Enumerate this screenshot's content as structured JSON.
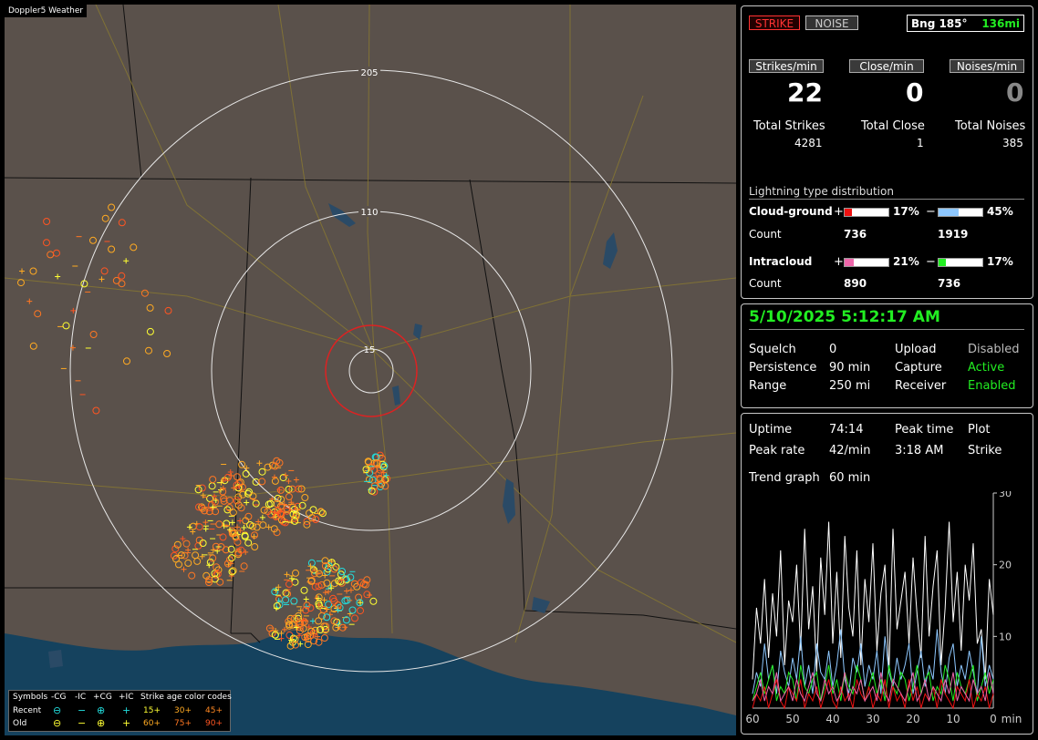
{
  "map": {
    "title": "Doppler5 Weather",
    "range_labels": [
      "205",
      "110",
      "15"
    ]
  },
  "legend": {
    "symbols_label": "Symbols",
    "headers": [
      "-CG",
      "-IC",
      "+CG",
      "+IC"
    ],
    "age_label": "Strike age color codes",
    "recent_label": "Recent",
    "old_label": "Old",
    "recent_ages": [
      "15+",
      "30+",
      "45+"
    ],
    "old_ages": [
      "60+",
      "75+",
      "90+"
    ],
    "age_colors": [
      "#ffff33",
      "#ffaa22",
      "#ff7722",
      "#ffaa22",
      "#ff7722",
      "#ff5522"
    ]
  },
  "top": {
    "strike_btn": "STRIKE",
    "noise_btn": "NOISE",
    "bearing": "Bng 185°",
    "distance": "136mi",
    "strikes_per_min_label": "Strikes/min",
    "close_per_min_label": "Close/min",
    "noises_per_min_label": "Noises/min",
    "strikes_per_min": "22",
    "close_per_min": "0",
    "noises_per_min": "0",
    "total_strikes_label": "Total Strikes",
    "total_close_label": "Total Close",
    "total_noises_label": "Total Noises",
    "total_strikes": "4281",
    "total_close": "1",
    "total_noises": "385",
    "dist_title": "Lightning type distribution",
    "cg_label": "Cloud-ground",
    "ic_label": "Intracloud",
    "count_label": "Count",
    "plus": "+",
    "minus": "−",
    "cg_plus_pct": "17%",
    "cg_minus_pct": "45%",
    "cg_plus_count": "736",
    "cg_minus_count": "1919",
    "ic_plus_pct": "21%",
    "ic_minus_pct": "17%",
    "ic_plus_count": "890",
    "ic_minus_count": "736",
    "bar_fractions": {
      "cg_plus": 0.17,
      "cg_minus": 0.45,
      "ic_plus": 0.21,
      "ic_minus": 0.17
    },
    "bar_colors": {
      "cg_plus": "#ee1111",
      "cg_minus": "#8ec8ff",
      "ic_plus": "#ee66aa",
      "ic_minus": "#22ee22"
    }
  },
  "status": {
    "datetime": "5/10/2025 5:12:17 AM",
    "squelch_label": "Squelch",
    "squelch": "0",
    "persistence_label": "Persistence",
    "persistence": "90 min",
    "range_label": "Range",
    "range": "250 mi",
    "upload_label": "Upload",
    "upload": "Disabled",
    "capture_label": "Capture",
    "capture": "Active",
    "receiver_label": "Receiver",
    "receiver": "Enabled"
  },
  "trend": {
    "uptime_label": "Uptime",
    "uptime": "74:14",
    "peak_time_label": "Peak time",
    "peak_time": "3:18 AM",
    "plot_label": "Plot",
    "peak_rate_label": "Peak rate",
    "peak_rate": "42/min",
    "plot_value": "Strike",
    "trend_label": "Trend graph",
    "trend_value": "60 min",
    "x_ticks": [
      "60",
      "50",
      "40",
      "30",
      "20",
      "10",
      "0"
    ],
    "x_unit": "min",
    "y_ticks": [
      "30",
      "20",
      "10"
    ]
  },
  "chart_data": {
    "type": "line",
    "xlim": [
      60,
      0
    ],
    "ylim": [
      0,
      30
    ],
    "x_ticks": [
      60,
      50,
      40,
      30,
      20,
      10,
      0
    ],
    "y_ticks": [
      30,
      20,
      10
    ],
    "xlabel": "min",
    "series": [
      {
        "color": "#ffffff",
        "values": [
          4,
          14,
          9,
          18,
          7,
          16,
          10,
          22,
          6,
          15,
          12,
          20,
          8,
          25,
          11,
          17,
          5,
          21,
          13,
          26,
          9,
          19,
          7,
          24,
          14,
          10,
          22,
          6,
          18,
          12,
          23,
          8,
          16,
          20,
          5,
          25,
          11,
          15,
          19,
          9,
          21,
          13,
          7,
          24,
          10,
          17,
          22,
          6,
          14,
          26,
          12,
          19,
          8,
          20,
          15,
          23,
          9,
          11,
          4,
          18,
          13
        ]
      },
      {
        "color": "#8ec8ff",
        "values": [
          2,
          5,
          3,
          9,
          4,
          6,
          2,
          8,
          5,
          3,
          7,
          4,
          10,
          3,
          6,
          2,
          9,
          5,
          4,
          8,
          3,
          6,
          11,
          4,
          2,
          7,
          5,
          9,
          3,
          6,
          4,
          8,
          2,
          10,
          5,
          3,
          7,
          4,
          6,
          9,
          2,
          5,
          8,
          3,
          6,
          4,
          11,
          5,
          2,
          7,
          9,
          3,
          6,
          4,
          8,
          5,
          2,
          10,
          3,
          6,
          4
        ]
      },
      {
        "color": "#22ee22",
        "values": [
          1,
          3,
          5,
          2,
          4,
          6,
          1,
          3,
          2,
          5,
          4,
          1,
          6,
          3,
          2,
          4,
          5,
          1,
          3,
          6,
          2,
          4,
          1,
          5,
          3,
          2,
          6,
          4,
          1,
          3,
          5,
          2,
          4,
          1,
          6,
          3,
          2,
          5,
          4,
          1,
          3,
          6,
          2,
          4,
          5,
          1,
          3,
          2,
          6,
          4,
          1,
          5,
          3,
          2,
          4,
          6,
          1,
          3,
          5,
          2,
          4
        ]
      },
      {
        "color": "#ee1111",
        "values": [
          0,
          2,
          1,
          3,
          0,
          2,
          4,
          1,
          0,
          3,
          2,
          1,
          4,
          0,
          2,
          1,
          3,
          0,
          2,
          4,
          1,
          0,
          3,
          1,
          2,
          0,
          4,
          2,
          1,
          3,
          0,
          2,
          1,
          4,
          0,
          3,
          1,
          2,
          0,
          4,
          1,
          3,
          0,
          2,
          1,
          3,
          0,
          4,
          2,
          1,
          0,
          3,
          2,
          1,
          4,
          0,
          2,
          1,
          3,
          0,
          2
        ]
      },
      {
        "color": "#ee66aa",
        "values": [
          1,
          2,
          4,
          1,
          3,
          2,
          5,
          1,
          2,
          3,
          1,
          4,
          2,
          1,
          3,
          5,
          2,
          1,
          4,
          2,
          3,
          1,
          2,
          5,
          1,
          3,
          2,
          4,
          1,
          2,
          3,
          1,
          5,
          2,
          1,
          4,
          3,
          2,
          1,
          3,
          5,
          1,
          2,
          4,
          1,
          3,
          2,
          1,
          4,
          2,
          5,
          1,
          3,
          2,
          1,
          4,
          2,
          3,
          1,
          5,
          2
        ]
      }
    ]
  }
}
